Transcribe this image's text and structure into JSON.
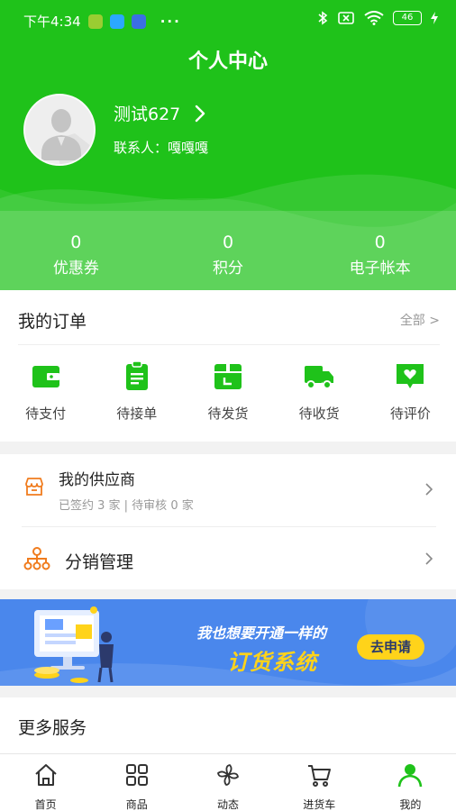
{
  "status_bar": {
    "time": "下午4:34",
    "dots": "···",
    "battery": "46"
  },
  "header": {
    "title": "个人中心"
  },
  "profile": {
    "name": "测试627",
    "contact_label": "联系人：",
    "contact_name": "嘎嘎嘎"
  },
  "stats": [
    {
      "value": "0",
      "label": "优惠券"
    },
    {
      "value": "0",
      "label": "积分"
    },
    {
      "value": "0",
      "label": "电子帐本"
    }
  ],
  "orders": {
    "title": "我的订单",
    "all_label": "全部 >",
    "items": [
      {
        "label": "待支付",
        "icon": "wallet-icon"
      },
      {
        "label": "待接单",
        "icon": "clipboard-icon"
      },
      {
        "label": "待发货",
        "icon": "package-icon"
      },
      {
        "label": "待收货",
        "icon": "truck-icon"
      },
      {
        "label": "待评价",
        "icon": "heart-message-icon"
      }
    ]
  },
  "supplier": {
    "title": "我的供应商",
    "subtitle": "已签约 3 家 | 待审核 0 家"
  },
  "distribution": {
    "title": "分销管理"
  },
  "banner": {
    "line1": "我也想要开通一样的",
    "line2": "订货系统",
    "button": "去申请"
  },
  "more_services": {
    "title": "更多服务"
  },
  "bottom_nav": [
    {
      "label": "首页",
      "icon": "home-icon"
    },
    {
      "label": "商品",
      "icon": "grid-icon"
    },
    {
      "label": "动态",
      "icon": "pinwheel-icon"
    },
    {
      "label": "进货车",
      "icon": "cart-icon"
    },
    {
      "label": "我的",
      "icon": "user-icon"
    }
  ],
  "colors": {
    "brand_green": "#1fc21a",
    "orange_accent": "#f07c1e",
    "banner_blue": "#4a87ec",
    "banner_yellow": "#ffd31a"
  }
}
